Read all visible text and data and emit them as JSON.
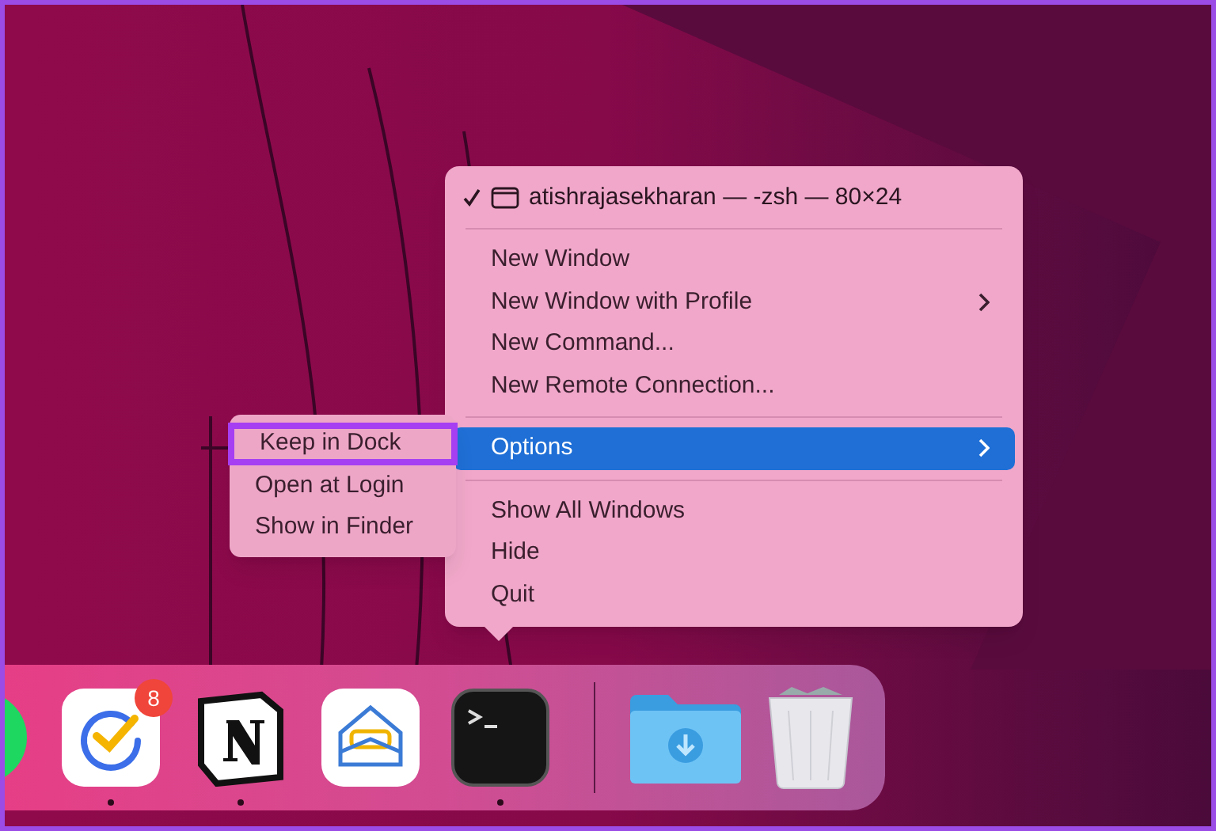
{
  "menu": {
    "window_item": {
      "title": "atishrajasekharan — -zsh — 80×24",
      "checked": true
    },
    "groups": [
      {
        "items": [
          {
            "label": "New Window",
            "submenu": false,
            "selected": false
          },
          {
            "label": "New Window with Profile",
            "submenu": true,
            "selected": false
          },
          {
            "label": "New Command...",
            "submenu": false,
            "selected": false
          },
          {
            "label": "New Remote Connection...",
            "submenu": false,
            "selected": false
          }
        ]
      },
      {
        "items": [
          {
            "label": "Options",
            "submenu": true,
            "selected": true
          }
        ]
      },
      {
        "items": [
          {
            "label": "Show All Windows",
            "submenu": false,
            "selected": false
          },
          {
            "label": "Hide",
            "submenu": false,
            "selected": false
          },
          {
            "label": "Quit",
            "submenu": false,
            "selected": false
          }
        ]
      }
    ]
  },
  "submenu": {
    "items": [
      {
        "label": "Keep in Dock",
        "highlighted": true
      },
      {
        "label": "Open at Login",
        "highlighted": false
      },
      {
        "label": "Show in Finder",
        "highlighted": false
      }
    ]
  },
  "dock": {
    "apps": [
      {
        "kind": "green"
      },
      {
        "kind": "tasks",
        "running": true,
        "badge": "8"
      },
      {
        "kind": "notes",
        "running": true
      },
      {
        "kind": "mail"
      },
      {
        "kind": "terminal",
        "running": true
      }
    ],
    "stacks": [
      {
        "kind": "downloads"
      },
      {
        "kind": "trash"
      }
    ]
  }
}
